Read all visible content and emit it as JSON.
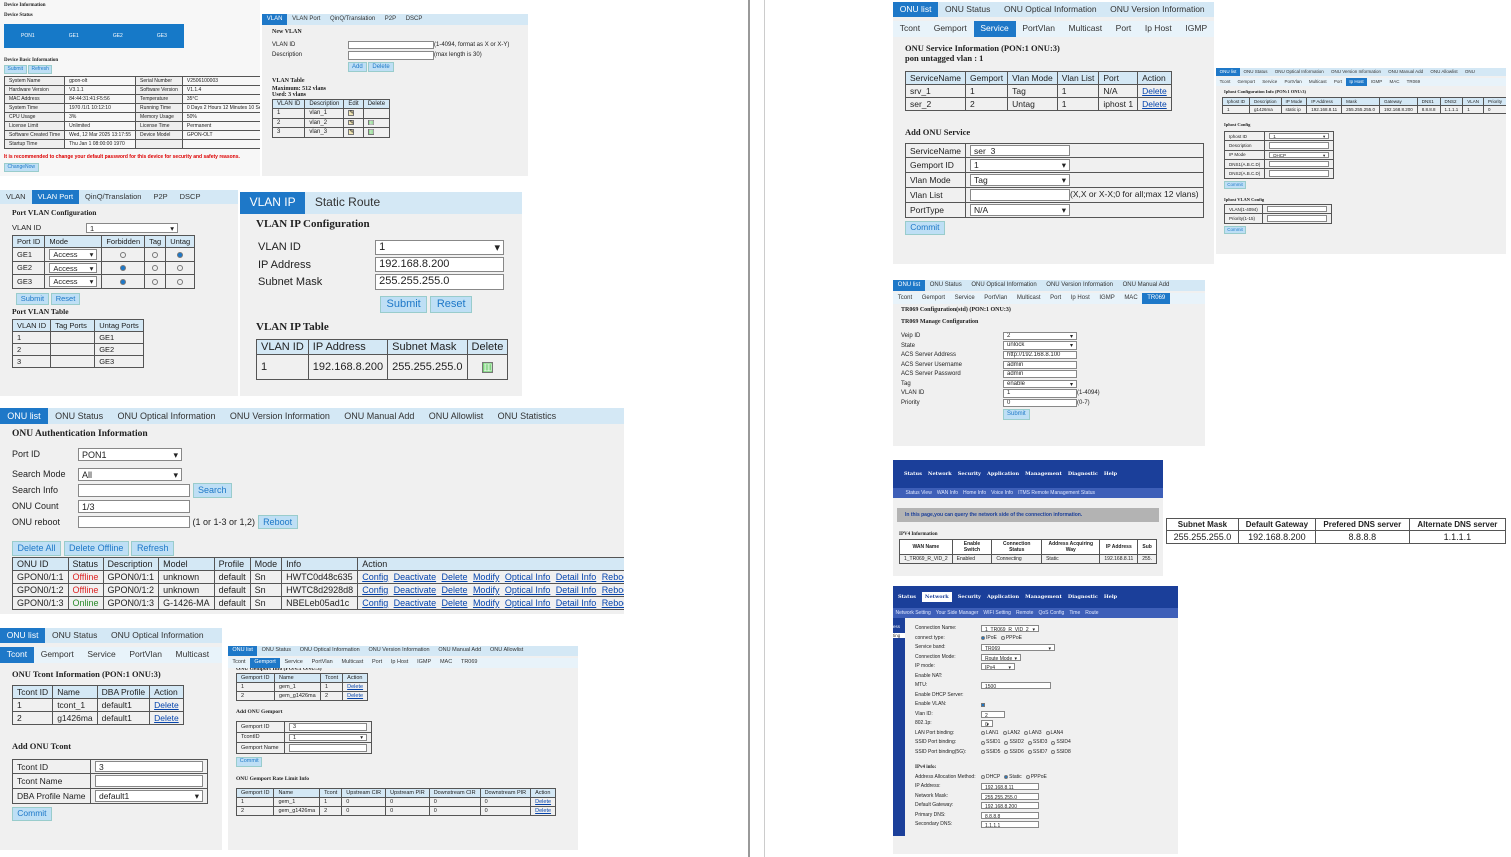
{
  "device": {
    "title": "Device Information",
    "status": "Device Status",
    "ports": [
      "PON1",
      "GE1",
      "GE2",
      "GE3"
    ],
    "basic": "Device Basic Information",
    "buttons": [
      "Submit",
      "Refresh"
    ],
    "rows": [
      [
        "System Name",
        "gpon-olt",
        "Serial Number",
        "V2506100003"
      ],
      [
        "Hardware Version",
        "V3.1.1",
        "Software Version",
        "V1.1.4"
      ],
      [
        "MAC Address",
        "84:44:31:41:F5:56",
        "Temperature",
        "35°C"
      ],
      [
        "System Time",
        "1970 /1/1 10:12:10",
        "Running Time",
        "0 Days 2 Hours 12 Minutes 10 Seconds"
      ],
      [
        "CPU Usage",
        "3%",
        "Memory Usage",
        "50%"
      ],
      [
        "License Limit",
        "Unlimited",
        "License Time",
        "Permanent"
      ],
      [
        "Software Created Time",
        "Wed, 12 Mar 2025 13:17:55",
        "Device Model",
        "GPON-OLT"
      ],
      [
        "Startup Time",
        "Thu Jan 1 08:00:00 1970",
        "",
        ""
      ]
    ],
    "warning": "It is recommended to change your default password for this device for security and safety reasons.",
    "change": "ChangeNow"
  },
  "vlan": {
    "tabs": [
      "VLAN",
      "VLAN Port",
      "QinQ/Translation",
      "P2P",
      "DSCP"
    ],
    "new": "New VLAN",
    "id_label": "VLAN ID",
    "id_hint": "(1-4094, format as X or X-Y)",
    "desc_label": "Description",
    "desc_hint": "(max length is 30)",
    "add": "Add",
    "del": "Delete",
    "table": "VLAN Table",
    "max": "Maximum: 512 vlans",
    "used": "Used: 3 vlans",
    "headers": [
      "VLAN ID",
      "Description",
      "Edit",
      "Delete"
    ],
    "rows": [
      [
        "1",
        "vlan_1"
      ],
      [
        "2",
        "vlan_2"
      ],
      [
        "3",
        "vlan_3"
      ]
    ]
  },
  "vport": {
    "tabs": [
      "VLAN",
      "VLAN Port",
      "QinQ/Translation",
      "P2P",
      "DSCP"
    ],
    "title": "Port VLAN Configuration",
    "id_label": "VLAN ID",
    "id_val": "1",
    "headers": [
      "Port ID",
      "Mode",
      "Forbidden",
      "Tag",
      "Untag"
    ],
    "rows": [
      [
        "GE1",
        "Access"
      ],
      [
        "GE2",
        "Access"
      ],
      [
        "GE3",
        "Access"
      ]
    ],
    "submit": "Submit",
    "reset": "Reset",
    "table": "Port VLAN Table",
    "theaders": [
      "VLAN ID",
      "Tag Ports",
      "Untag Ports"
    ],
    "trows": [
      [
        "1",
        "",
        "GE1"
      ],
      [
        "2",
        "",
        "GE2"
      ],
      [
        "3",
        "",
        "GE3"
      ]
    ]
  },
  "vip": {
    "tabs": [
      "VLAN IP",
      "Static Route"
    ],
    "title": "VLAN IP Configuration",
    "labels": [
      "VLAN ID",
      "IP Address",
      "Subnet Mask"
    ],
    "values": [
      "1",
      "192.168.8.200",
      "255.255.255.0"
    ],
    "submit": "Submit",
    "reset": "Reset",
    "table": "VLAN IP Table",
    "headers": [
      "VLAN ID",
      "IP Address",
      "Subnet Mask",
      "Delete"
    ],
    "row": [
      "1",
      "192.168.8.200",
      "255.255.255.0"
    ]
  },
  "onu": {
    "tabs": [
      "ONU list",
      "ONU Status",
      "ONU Optical Information",
      "ONU Version Information",
      "ONU Manual Add",
      "ONU Allowlist",
      "ONU Statistics"
    ],
    "title": "ONU Authentication Information",
    "port_label": "Port ID",
    "port": "PON1",
    "mode_label": "Search Mode",
    "mode": "All",
    "info_label": "Search Info",
    "search": "Search",
    "count_label": "ONU Count",
    "count": "1/3",
    "reboot_label": "ONU reboot",
    "reboot_hint": "(1 or 1-3 or 1,2)",
    "reboot": "Reboot",
    "btns": [
      "Delete All",
      "Delete Offline",
      "Refresh"
    ],
    "headers": [
      "ONU ID",
      "Status",
      "Description",
      "Model",
      "Profile",
      "Mode",
      "Info",
      "Action"
    ],
    "rows": [
      [
        "GPON0/1:1",
        "Offline",
        "GPON0/1:1",
        "unknown",
        "default",
        "Sn",
        "HWTC0d48c635"
      ],
      [
        "GPON0/1:2",
        "Offline",
        "GPON0/1:2",
        "unknown",
        "default",
        "Sn",
        "HWTC8d2928d8"
      ],
      [
        "GPON0/1:3",
        "Online",
        "GPON0/1:3",
        "G-1426-MA",
        "default",
        "Sn",
        "NBELeb05ad1c"
      ]
    ],
    "actions": [
      "Config",
      "Deactivate",
      "Delete",
      "Modify",
      "Optical Info",
      "Detail Info",
      "Reboot"
    ]
  },
  "tcont": {
    "tabs": [
      "ONU list",
      "ONU Status",
      "ONU Optical Information"
    ],
    "sub": [
      "Tcont",
      "Gemport",
      "Service",
      "PortVlan",
      "Multicast"
    ],
    "title": "ONU Tcont Information (PON:1 ONU:3)",
    "headers": [
      "Tcont ID",
      "Name",
      "DBA Profile",
      "Action"
    ],
    "rows": [
      [
        "1",
        "tcont_1",
        "default1",
        "Delete"
      ],
      [
        "2",
        "g1426ma",
        "default1",
        "Delete"
      ]
    ],
    "add": "Add ONU Tcont",
    "labels": [
      "Tcont ID",
      "Tcont Name",
      "DBA Profile Name"
    ],
    "values": [
      "3",
      "",
      "default1"
    ],
    "commit": "Commit"
  },
  "gem": {
    "tabs": [
      "ONU list",
      "ONU Status",
      "ONU Optical Information",
      "ONU Version Information",
      "ONU Manual Add",
      "ONU Allowlist"
    ],
    "sub": [
      "Tcont",
      "Gemport",
      "Service",
      "PortVlan",
      "Multicast",
      "Port",
      "Ip Host",
      "IGMP",
      "MAC",
      "TR069"
    ],
    "cut": "ONU Gemport Info (PON:1 ONU:3)",
    "headers": [
      "Gemport ID",
      "Name",
      "Tcont",
      "Action"
    ],
    "rows": [
      [
        "1",
        "gem_1",
        "1",
        "Delete"
      ],
      [
        "2",
        "gem_g1426ma",
        "2",
        "Delete"
      ]
    ],
    "add": "Add ONU Gemport",
    "labels": [
      "Gemport ID",
      "TcontID",
      "Gemport Name"
    ],
    "values": [
      "3",
      "1",
      ""
    ],
    "commit": "Commit",
    "rate": "ONU Gemport Rate Limit Info",
    "rheaders": [
      "Gemport ID",
      "Name",
      "Tcont",
      "Upstream CIR",
      "Upstream PIR",
      "Downstream CIR",
      "Downstream PIR",
      "Action"
    ],
    "rrows": [
      [
        "1",
        "gem_1",
        "1",
        "0",
        "0",
        "0",
        "0",
        "Delete"
      ],
      [
        "2",
        "gem_g1426ma",
        "2",
        "0",
        "0",
        "0",
        "0",
        "Delete"
      ]
    ]
  },
  "svc": {
    "tabs": [
      "ONU list",
      "ONU Status",
      "ONU Optical Information",
      "ONU Version Information"
    ],
    "sub": [
      "Tcont",
      "Gemport",
      "Service",
      "PortVlan",
      "Multicast",
      "Port",
      "Ip Host",
      "IGMP"
    ],
    "title": "ONU Service Information (PON:1 ONU:3)",
    "untag": "pon untagged vlan : 1",
    "headers": [
      "ServiceName",
      "Gemport",
      "Vlan Mode",
      "Vlan List",
      "Port",
      "Action"
    ],
    "rows": [
      [
        "srv_1",
        "1",
        "Tag",
        "1",
        "N/A",
        "Delete"
      ],
      [
        "ser_2",
        "2",
        "Untag",
        "1",
        "iphost 1",
        "Delete"
      ]
    ],
    "add": "Add ONU Service",
    "labels": [
      "ServiceName",
      "Gemport ID",
      "Vlan Mode",
      "Vlan List",
      "PortType"
    ],
    "values": [
      "ser_3",
      "1",
      "Tag",
      "",
      "N/A"
    ],
    "hint": "(X,X or X-X;0 for all;max 12 vlans)",
    "commit": "Commit"
  },
  "iph": {
    "tabs": [
      "ONU list",
      "ONU Status",
      "ONU Optical Information",
      "ONU Version Information",
      "ONU Manual Add",
      "ONU Allowlist",
      "ONU"
    ],
    "sub": [
      "Tcont",
      "Gemport",
      "Service",
      "PortVlan",
      "Multicast",
      "Port",
      "Ip Host",
      "IGMP",
      "MAC",
      "TR069"
    ],
    "title": "Iphost Configuration Info (PON:1 ONU:3)",
    "headers": [
      "Iphost ID",
      "Description",
      "IP Mode",
      "IP Address",
      "Mask",
      "Gateway",
      "DNS1",
      "DNS2",
      "VLAN",
      "Priority",
      "Action"
    ],
    "row": [
      "1",
      "g1426ma",
      "static ip",
      "192.168.8.11",
      "255.255.255.0",
      "192.168.8.200",
      "8.8.8.8",
      "1.1.1.1",
      "1",
      "0",
      "Delete"
    ],
    "cfg": "Iphost Config",
    "labels": [
      "Iphost ID",
      "Description",
      "IP Mode",
      "DNS1(A.B.C.D)",
      "DNS2(A.B.C.D)"
    ],
    "values": [
      "1",
      "",
      "DHCP",
      "",
      ""
    ],
    "commit": "Commit",
    "vcfg": "Iphost VLAN Config",
    "vlabels": [
      "VLAN(1-4094)",
      "Priority(1-15)"
    ]
  },
  "tr": {
    "tabs": [
      "ONU list",
      "ONU Status",
      "ONU Optical Information",
      "ONU Version Information",
      "ONU Manual Add"
    ],
    "sub": [
      "Tcont",
      "Gemport",
      "Service",
      "PortVlan",
      "Multicast",
      "Port",
      "Ip Host",
      "IGMP",
      "MAC",
      "TR069"
    ],
    "title": "TR069 Configuration(std) (PON:1 ONU:3)",
    "manage": "TR069 Manage Configuration",
    "labels": [
      "Veip ID",
      "State",
      "ACS Server Address",
      "ACS Server Username",
      "ACS Server Password",
      "Tag",
      "VLAN ID",
      "Priority"
    ],
    "values": [
      "2",
      "unlock",
      "http://192.168.8.100",
      "admin",
      "admin",
      "enable",
      "1",
      "0"
    ],
    "hints": [
      "",
      "",
      "",
      "",
      "",
      "",
      "(1-4094)",
      "(0-7)"
    ],
    "submit": "Submit"
  },
  "st": {
    "nav": [
      "Status",
      "Network",
      "Security",
      "Application",
      "Management",
      "Diagnostic",
      "Help"
    ],
    "sub": [
      "Status View",
      "WAN Info",
      "Home Info",
      "Voice Info",
      "ITMS Remote Management Status"
    ],
    "note": "In this page,you can query the network side of the connection information.",
    "ipv4": "IPV4 Information",
    "headers": [
      "WAN Name",
      "Enable Switch",
      "Connection Status",
      "Address Acquiring Way",
      "IP Address",
      "Sub"
    ],
    "row": [
      "1_TR069_R_VID_2",
      "Enabled",
      "Connecting",
      "Static",
      "192.168.8.11",
      "255."
    ]
  },
  "dns": {
    "headers": [
      "Subnet Mask",
      "Default Gateway",
      "Prefered DNS server",
      "Alternate DNS server"
    ],
    "row": [
      "255.255.255.0",
      "192.168.8.200",
      "8.8.8.8",
      "1.1.1.1"
    ]
  },
  "net": {
    "nav": [
      "Status",
      "Network",
      "Security",
      "Application",
      "Management",
      "Diagnostic",
      "Help"
    ],
    "sub": [
      "Network Setting",
      "Your Side Manager",
      "WIFI Setting",
      "Remote",
      "QoS Config",
      "Time",
      "Route"
    ],
    "side": [
      "ess",
      "ting"
    ],
    "labels": [
      "Connection Name:",
      "connect type:",
      "Service band:",
      "Connection Mode:",
      "IP mode:",
      "Enable NAT:",
      "MTU:",
      "Enable DHCP Server:",
      "Enable VLAN:",
      "Vlan ID:",
      "802.1p:",
      "LAN Port binding:",
      "SSID Port binding:",
      "SSID Port binding(5G):"
    ],
    "conn": "1_TR069_R_VID_2",
    "types": [
      "IPoE",
      "PPPoE"
    ],
    "band": "TR069",
    "mode": "Route Mode",
    "ipmode": "IPv4",
    "mtu": "1500",
    "vlan": "2",
    "p8021": "0",
    "lan": [
      "LAN1",
      "LAN2",
      "LAN3",
      "LAN4"
    ],
    "ssid": [
      "SSID1",
      "SSID2",
      "SSID3",
      "SSID4"
    ],
    "ssid5": [
      "SSID5",
      "SSID6",
      "SSID7",
      "SSID8"
    ],
    "ipv4": "IPv4 info:",
    "alloc_label": "Address Allocation Method:",
    "alloc": [
      "DHCP",
      "Static",
      "PPPoE"
    ],
    "ilabels": [
      "IP Address:",
      "Network Mask:",
      "Default Gateway:",
      "Primary DNS:",
      "Secondary DNS:"
    ],
    "ivalues": [
      "192.168.8.11",
      "255.255.255.0",
      "192.168.8.200",
      "8.8.8.8",
      "1.1.1.1"
    ]
  }
}
